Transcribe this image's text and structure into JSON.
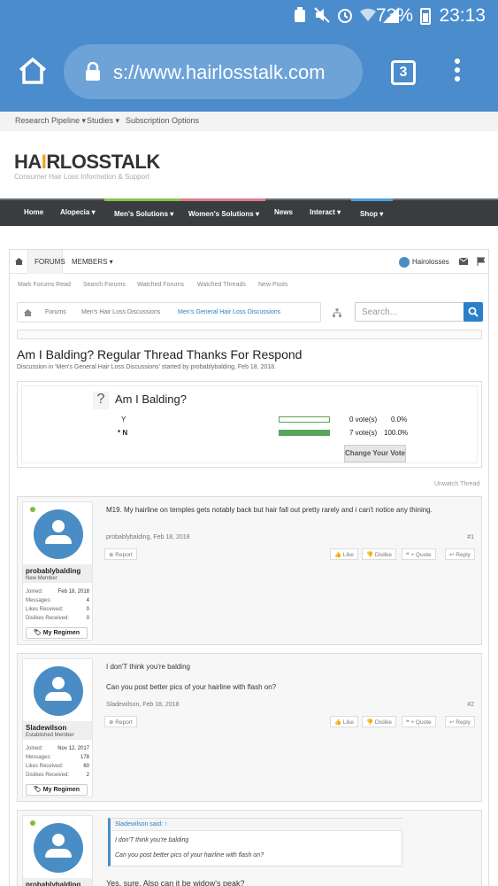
{
  "status": {
    "battery": "73%",
    "time": "23:13"
  },
  "browser": {
    "url": "s://www.hairlosstalk.com",
    "tab_count": "3"
  },
  "topnav": [
    "Research Pipeline ▾",
    "Studies ▾",
    "Subscription Options"
  ],
  "brand": {
    "logo_a": "HA",
    "logo_flame": "I",
    "logo_b": "RLOSSTALK",
    "tagline": "Consumer Hair Loss Information & Support"
  },
  "mainnav": [
    {
      "label": "Home",
      "bar": ""
    },
    {
      "label": "Alopecia ▾",
      "bar": ""
    },
    {
      "label": "Men's Solutions ▾",
      "bar": "#8bc34a"
    },
    {
      "label": "Women's Solutions ▾",
      "bar": "#e07a8a"
    },
    {
      "label": "News",
      "bar": ""
    },
    {
      "label": "Interact ▾",
      "bar": ""
    },
    {
      "label": "Shop ▾",
      "bar": "#4aa3d8"
    }
  ],
  "forum": {
    "tab_forums": "FORUMS",
    "tab_members": "MEMBERS ▾",
    "user": "Hairolosses",
    "subnav": [
      "Mark Forums Read",
      "Search Forums",
      "Watched Forums",
      "Watched Threads",
      "New Posts"
    ],
    "crumbs": [
      "Forums",
      "Men's Hair Loss Discussions",
      "Men's General Hair Loss Discussions"
    ],
    "search_placeholder": "Search..."
  },
  "thread": {
    "title": "Am I Balding? Regular Thread Thanks For Respond",
    "subtitle": "Discussion in 'Men's General Hair Loss Discussions' started by probablybalding, Feb 18, 2018.",
    "unwatch": "Unwatch Thread"
  },
  "poll": {
    "question": "Am I Balding?",
    "mark": "?",
    "options": [
      {
        "label": "Y",
        "votes": "0 vote(s)",
        "pct": "0.0%",
        "fraction": 0
      },
      {
        "label": "* N",
        "votes": "7 vote(s)",
        "pct": "100.0%",
        "fraction": 1
      }
    ],
    "button": "Change Your Vote"
  },
  "post_actions": {
    "report": "Report",
    "like": "Like",
    "dislike": "Dislike",
    "quote": "+ Quote",
    "reply": "Reply",
    "regimen": "My Regimen"
  },
  "stat_labels": {
    "joined": "Joined:",
    "messages": "Messages:",
    "likes": "Likes Received:",
    "dislikes": "Dislikes Received:"
  },
  "posts": [
    {
      "user": "probablybalding",
      "role": "New Member",
      "joined": "Feb 18, 2018",
      "messages": "4",
      "likes": "0",
      "dislikes": "0",
      "text1": "M19. My hairline on temples gets notably back but hair fall out pretty rarely and i can't notice any thining.",
      "text2": "",
      "meta": "probablybalding, Feb 18, 2018",
      "num": "#1"
    },
    {
      "user": "Sladewilson",
      "role": "Established Member",
      "joined": "Nov 12, 2017",
      "messages": "178",
      "likes": "60",
      "dislikes": "2",
      "text1": "I don'T think you're balding",
      "text2": "Can you post better pics of your hairline with flash on?",
      "meta": "Sladewilson, Feb 18, 2018",
      "num": "#2"
    },
    {
      "user": "probablybalding",
      "quote_head": "Sladewilson said: ↑",
      "quote1": "I don'T think you're balding",
      "quote2": "Can you post better pics of your hairline with flash on?",
      "text1": "Yes, sure. Also can it be widow's peak?"
    }
  ]
}
